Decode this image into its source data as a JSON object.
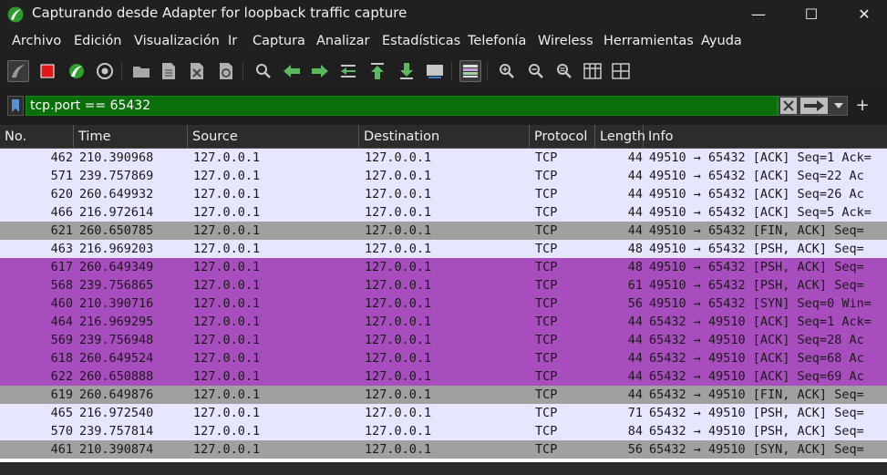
{
  "window": {
    "title": "Capturando desde Adapter for loopback traffic capture",
    "minimize_glyph": "—",
    "maximize_glyph": "☐",
    "close_glyph": "✕"
  },
  "menu": [
    "Archivo",
    "Edición",
    "Visualización",
    "Ir",
    "Captura",
    "Analizar",
    "Estadísticas",
    "Telefonía",
    "Wireless",
    "Herramientas",
    "Ayuda"
  ],
  "toolbar_icons": [
    "start-capture-icon",
    "stop-capture-icon",
    "restart-capture-icon",
    "capture-options-icon",
    "open-file-icon",
    "save-file-icon",
    "close-file-icon",
    "reload-file-icon",
    "find-packet-icon",
    "go-back-icon",
    "go-forward-icon",
    "go-to-packet-icon",
    "go-first-icon",
    "go-last-icon",
    "autoscroll-icon",
    "colorize-icon",
    "zoom-in-icon",
    "zoom-out-icon",
    "zoom-normal-icon",
    "resize-columns-icon",
    "layout-icon"
  ],
  "filter": {
    "value": "tcp.port == 65432",
    "add_glyph": "+"
  },
  "columns": [
    "No.",
    "Time",
    "Source",
    "Destination",
    "Protocol",
    "Length",
    "Info"
  ],
  "colors": {
    "row_default": "#e7e6ff",
    "row_purple": "#a84dbe",
    "row_gray": "#a0a0a0",
    "filter_green": "#0a6e0a"
  },
  "packets": [
    {
      "no": "462",
      "time": "210.390968",
      "src": "127.0.0.1",
      "dst": "127.0.0.1",
      "proto": "TCP",
      "len": "44",
      "info": "49510 → 65432 [ACK] Seq=1 Ack=",
      "color": "row_default"
    },
    {
      "no": "571",
      "time": "239.757869",
      "src": "127.0.0.1",
      "dst": "127.0.0.1",
      "proto": "TCP",
      "len": "44",
      "info": "49510 → 65432 [ACK] Seq=22 Ac",
      "color": "row_default"
    },
    {
      "no": "620",
      "time": "260.649932",
      "src": "127.0.0.1",
      "dst": "127.0.0.1",
      "proto": "TCP",
      "len": "44",
      "info": "49510 → 65432 [ACK] Seq=26 Ac",
      "color": "row_default"
    },
    {
      "no": "466",
      "time": "216.972614",
      "src": "127.0.0.1",
      "dst": "127.0.0.1",
      "proto": "TCP",
      "len": "44",
      "info": "49510 → 65432 [ACK] Seq=5 Ack=",
      "color": "row_default"
    },
    {
      "no": "621",
      "time": "260.650785",
      "src": "127.0.0.1",
      "dst": "127.0.0.1",
      "proto": "TCP",
      "len": "44",
      "info": "49510 → 65432 [FIN, ACK] Seq=",
      "color": "row_gray"
    },
    {
      "no": "463",
      "time": "216.969203",
      "src": "127.0.0.1",
      "dst": "127.0.0.1",
      "proto": "TCP",
      "len": "48",
      "info": "49510 → 65432 [PSH, ACK] Seq=",
      "color": "row_default"
    },
    {
      "no": "617",
      "time": "260.649349",
      "src": "127.0.0.1",
      "dst": "127.0.0.1",
      "proto": "TCP",
      "len": "48",
      "info": "49510 → 65432 [PSH, ACK] Seq=",
      "color": "row_purple"
    },
    {
      "no": "568",
      "time": "239.756865",
      "src": "127.0.0.1",
      "dst": "127.0.0.1",
      "proto": "TCP",
      "len": "61",
      "info": "49510 → 65432 [PSH, ACK] Seq=",
      "color": "row_purple"
    },
    {
      "no": "460",
      "time": "210.390716",
      "src": "127.0.0.1",
      "dst": "127.0.0.1",
      "proto": "TCP",
      "len": "56",
      "info": "49510 → 65432 [SYN] Seq=0 Win=",
      "color": "row_purple"
    },
    {
      "no": "464",
      "time": "216.969295",
      "src": "127.0.0.1",
      "dst": "127.0.0.1",
      "proto": "TCP",
      "len": "44",
      "info": "65432 → 49510 [ACK] Seq=1 Ack=",
      "color": "row_purple"
    },
    {
      "no": "569",
      "time": "239.756948",
      "src": "127.0.0.1",
      "dst": "127.0.0.1",
      "proto": "TCP",
      "len": "44",
      "info": "65432 → 49510 [ACK] Seq=28 Ac",
      "color": "row_purple"
    },
    {
      "no": "618",
      "time": "260.649524",
      "src": "127.0.0.1",
      "dst": "127.0.0.1",
      "proto": "TCP",
      "len": "44",
      "info": "65432 → 49510 [ACK] Seq=68 Ac",
      "color": "row_purple"
    },
    {
      "no": "622",
      "time": "260.650888",
      "src": "127.0.0.1",
      "dst": "127.0.0.1",
      "proto": "TCP",
      "len": "44",
      "info": "65432 → 49510 [ACK] Seq=69 Ac",
      "color": "row_purple"
    },
    {
      "no": "619",
      "time": "260.649876",
      "src": "127.0.0.1",
      "dst": "127.0.0.1",
      "proto": "TCP",
      "len": "44",
      "info": "65432 → 49510 [FIN, ACK] Seq=",
      "color": "row_gray"
    },
    {
      "no": "465",
      "time": "216.972540",
      "src": "127.0.0.1",
      "dst": "127.0.0.1",
      "proto": "TCP",
      "len": "71",
      "info": "65432 → 49510 [PSH, ACK] Seq=",
      "color": "row_default"
    },
    {
      "no": "570",
      "time": "239.757814",
      "src": "127.0.0.1",
      "dst": "127.0.0.1",
      "proto": "TCP",
      "len": "84",
      "info": "65432 → 49510 [PSH, ACK] Seq=",
      "color": "row_default"
    },
    {
      "no": "461",
      "time": "210.390874",
      "src": "127.0.0.1",
      "dst": "127.0.0.1",
      "proto": "TCP",
      "len": "56",
      "info": "65432 → 49510 [SYN, ACK] Seq=",
      "color": "row_gray"
    }
  ]
}
